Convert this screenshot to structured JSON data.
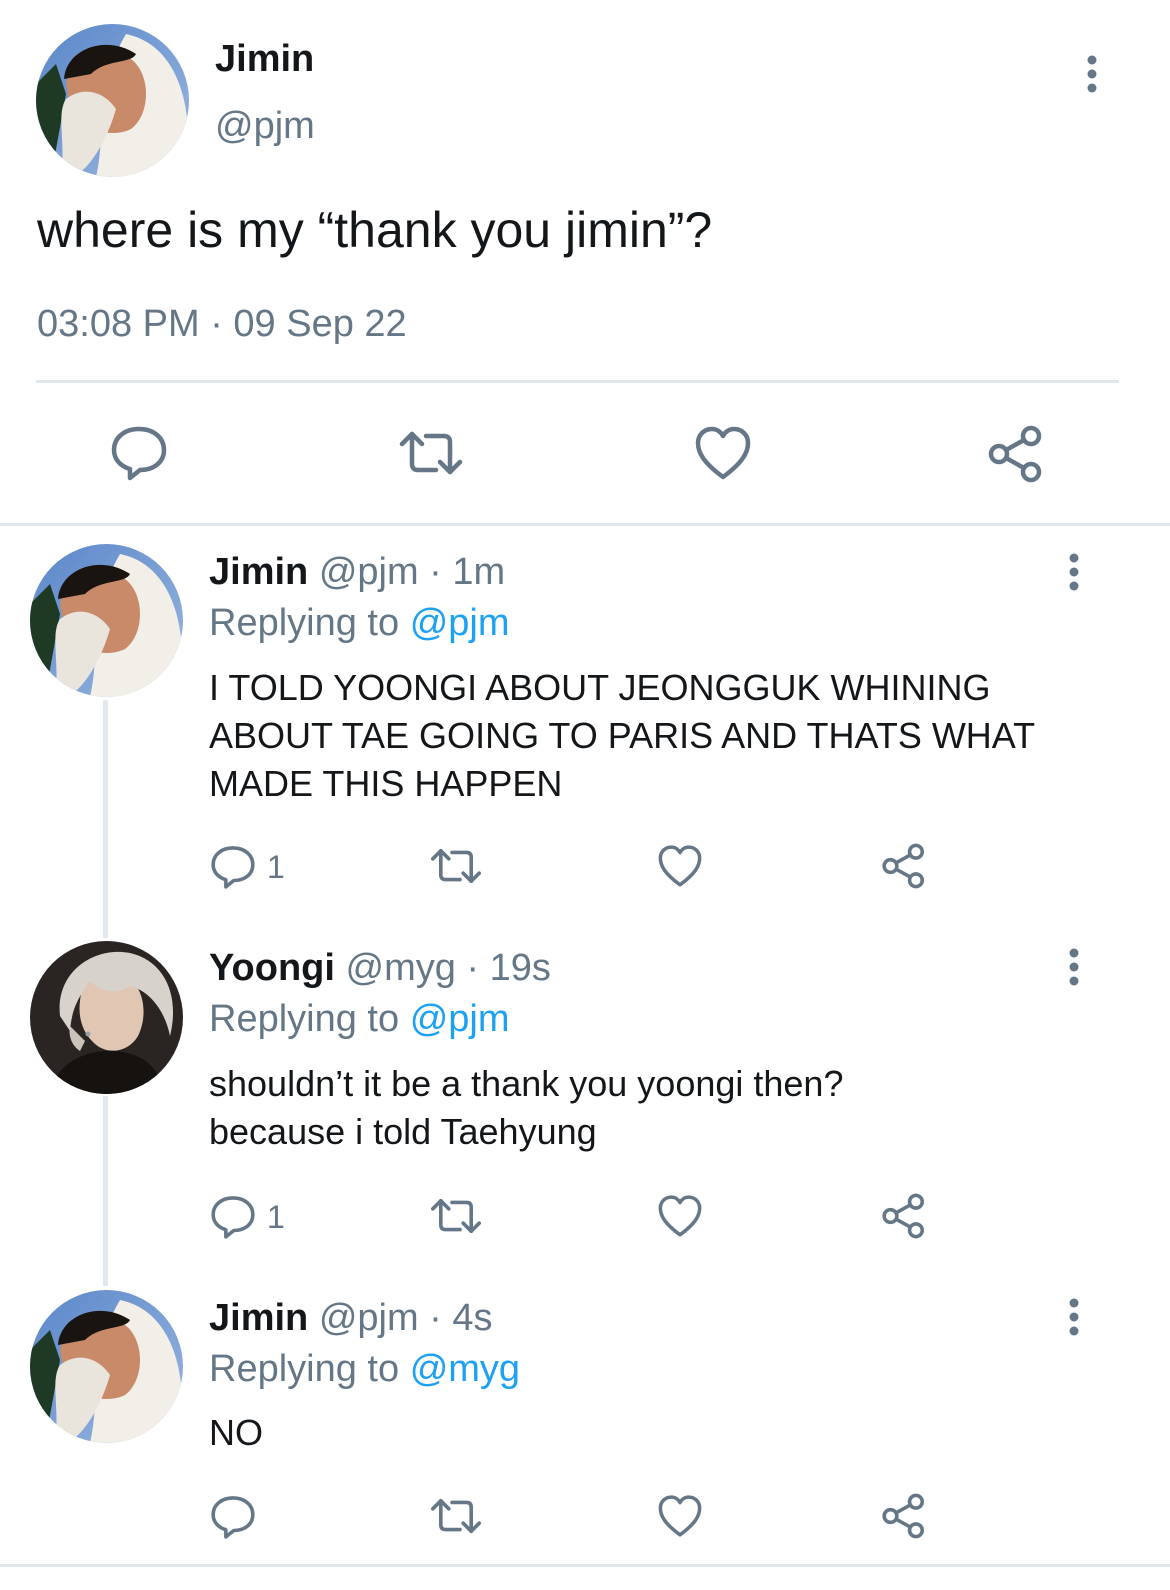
{
  "main_tweet": {
    "name": "Jimin",
    "handle": "@pjm",
    "text": "where is my “thank you jimin”?",
    "timestamp": "03:08 PM · 09 Sep 22"
  },
  "replies": [
    {
      "name": "Jimin",
      "meta": "@pjm · 1m",
      "replying_label": "Replying to",
      "replying_to": "@pjm",
      "text": "I TOLD YOONGI ABOUT JEONGGUK WHINING ABOUT TAE GOING TO PARIS AND THATS WHAT MADE THIS HAPPEN",
      "reply_count": "1"
    },
    {
      "name": "Yoongi",
      "meta": "@myg · 19s",
      "replying_label": "Replying to",
      "replying_to": "@pjm",
      "text": "shouldn’t it be a thank you yoongi then? because i told Taehyung",
      "reply_count": "1"
    },
    {
      "name": "Jimin",
      "meta": "@pjm · 4s",
      "replying_label": "Replying to",
      "replying_to": "@myg",
      "text": "NO",
      "reply_count": ""
    }
  ],
  "colors": {
    "text": "#14171a",
    "secondary": "#657786",
    "link": "#1da1f2",
    "divider": "#e1e8ed"
  }
}
